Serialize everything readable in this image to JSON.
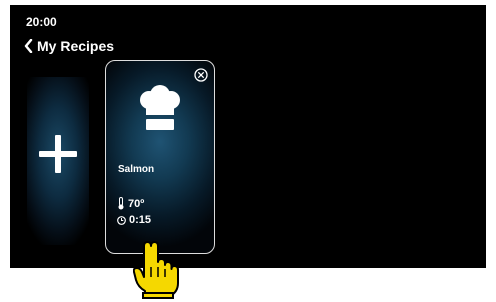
{
  "status": {
    "time": "20:00"
  },
  "header": {
    "title": "My Recipes"
  },
  "recipe": {
    "name": "Salmon",
    "temperature": "70º",
    "duration": "0:15"
  },
  "colors": {
    "background": "#000000",
    "accent_glow": "#1f5373",
    "pointer": "#f5d800"
  },
  "icons": {
    "back": "chevron-left-icon",
    "add": "plus-icon",
    "close": "close-circle-icon",
    "chef": "chef-hat-icon",
    "temperature": "thermometer-icon",
    "timer": "timer-icon",
    "pointer": "hand-pointer-icon"
  }
}
